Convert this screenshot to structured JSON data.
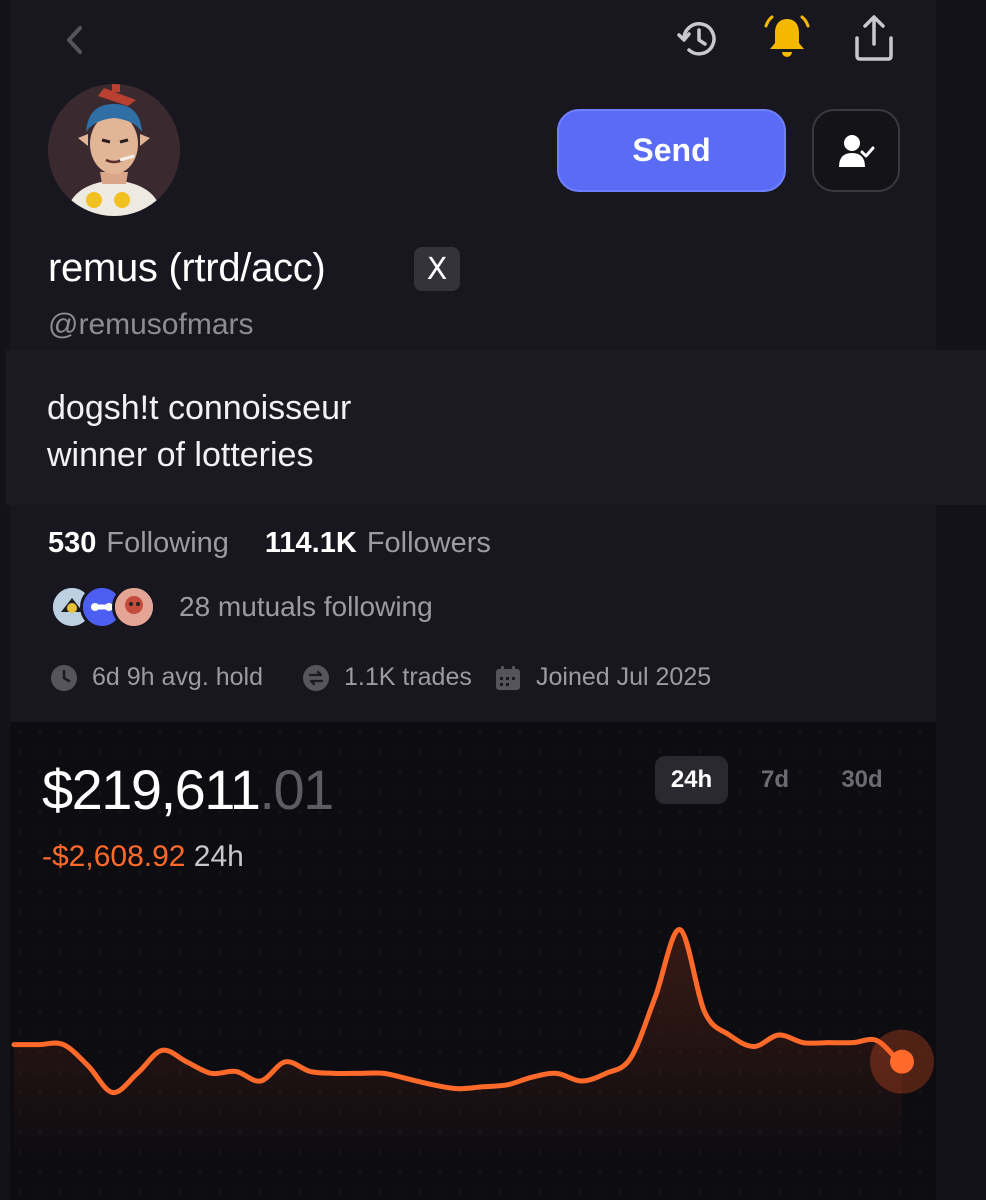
{
  "header": {
    "back_icon": "chevron-left-icon",
    "history_icon": "history-icon",
    "notification_icon": "bell-icon",
    "share_icon": "share-icon"
  },
  "profile": {
    "display_name": "remus (rtrd/acc)",
    "platform_badge": "X",
    "handle": "@remusofmars",
    "bio": [
      "dogsh!t connoisseur",
      "winner of lotteries"
    ],
    "send_label": "Send",
    "follow_icon": "user-check-icon"
  },
  "stats": {
    "following_count": "530",
    "following_label": "Following",
    "followers_count": "114.1K",
    "followers_label": "Followers"
  },
  "mutuals": {
    "text": "28 mutuals following"
  },
  "meta": {
    "avg_hold": "6d 9h avg. hold",
    "trades": "1.1K trades",
    "joined": "Joined Jul 2025"
  },
  "portfolio": {
    "value_whole": "$219,611",
    "value_cents": ".01",
    "change_amount": "-$2,608.92",
    "change_period": "24h",
    "ranges": [
      "24h",
      "7d",
      "30d"
    ],
    "selected_range": "24h"
  },
  "colors": {
    "accent": "#5a6cf5",
    "negative": "#ff6a2b",
    "notification": "#f5b800",
    "background": "#131218"
  },
  "chart_data": {
    "type": "line",
    "values": [
      55,
      55,
      55,
      44,
      30,
      40,
      52,
      46,
      40,
      41,
      36,
      46,
      41,
      40,
      40,
      40,
      37,
      34,
      32,
      33,
      34,
      38,
      40,
      36,
      40,
      48,
      80,
      115,
      72,
      60,
      54,
      60,
      56,
      56,
      56,
      57,
      44
    ],
    "ylim": [
      0,
      120
    ],
    "grid": false
  }
}
